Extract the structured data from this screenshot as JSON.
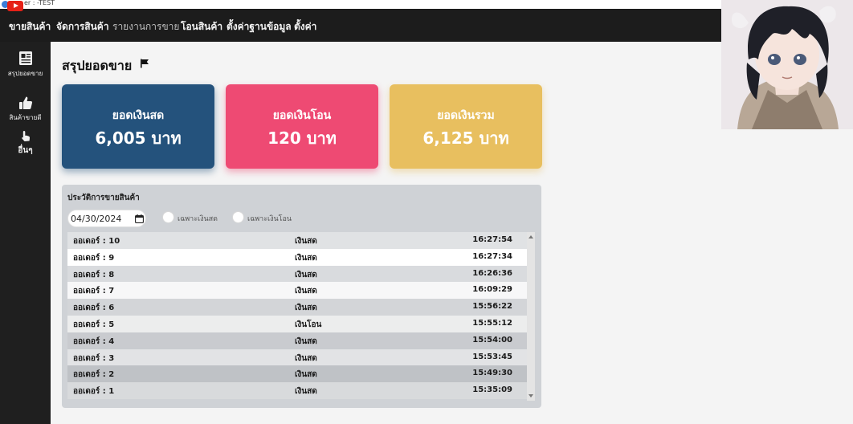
{
  "window": {
    "title": "er : -TEST"
  },
  "nav": {
    "items": [
      {
        "label": "ขายสินค้า"
      },
      {
        "label": "จัดการสินค้า"
      },
      {
        "label": "รายงานการขาย"
      },
      {
        "label": "โอนสินค้า"
      },
      {
        "label": "ตั้งค่าฐานข้อมูล"
      },
      {
        "label": "ตั้งค่า"
      }
    ]
  },
  "sidebar": {
    "items": [
      {
        "label": "สรุปยอดขาย",
        "icon": "newspaper-icon"
      },
      {
        "label": "สินค้าขายดี",
        "icon": "thumbs-up-icon"
      },
      {
        "label": "อื่นๆ",
        "icon": "pointer-hand-icon"
      }
    ]
  },
  "page": {
    "title": "สรุปยอดขาย"
  },
  "cards": [
    {
      "title": "ยอดเงินสด",
      "value": "6,005 บาท",
      "color": "#24527c"
    },
    {
      "title": "ยอดเงินโอน",
      "value": "120 บาท",
      "color": "#ee4a73"
    },
    {
      "title": "ยอดเงินรวม",
      "value": "6,125 บาท",
      "color": "#e8bf5f"
    }
  ],
  "history": {
    "title": "ประวัติการขายสินค้า",
    "date": "04/30/2024",
    "filters": [
      {
        "label": "เฉพาะเงินสด"
      },
      {
        "label": "เฉพาะเงินโอน"
      }
    ],
    "rows": [
      {
        "order": "ออเดอร์ : 10",
        "method": "เงินสด",
        "time": "16:27:54"
      },
      {
        "order": "ออเดอร์ : 9",
        "method": "เงินสด",
        "time": "16:27:34"
      },
      {
        "order": "ออเดอร์ : 8",
        "method": "เงินสด",
        "time": "16:26:36"
      },
      {
        "order": "ออเดอร์ : 7",
        "method": "เงินสด",
        "time": "16:09:29"
      },
      {
        "order": "ออเดอร์ : 6",
        "method": "เงินสด",
        "time": "15:56:22"
      },
      {
        "order": "ออเดอร์ : 5",
        "method": "เงินโอน",
        "time": "15:55:12"
      },
      {
        "order": "ออเดอร์ : 4",
        "method": "เงินสด",
        "time": "15:54:00"
      },
      {
        "order": "ออเดอร์ : 3",
        "method": "เงินสด",
        "time": "15:53:45"
      },
      {
        "order": "ออเดอร์ : 2",
        "method": "เงินสด",
        "time": "15:49:30"
      },
      {
        "order": "ออเดอร์ : 1",
        "method": "เงินสด",
        "time": "15:35:09"
      }
    ]
  }
}
